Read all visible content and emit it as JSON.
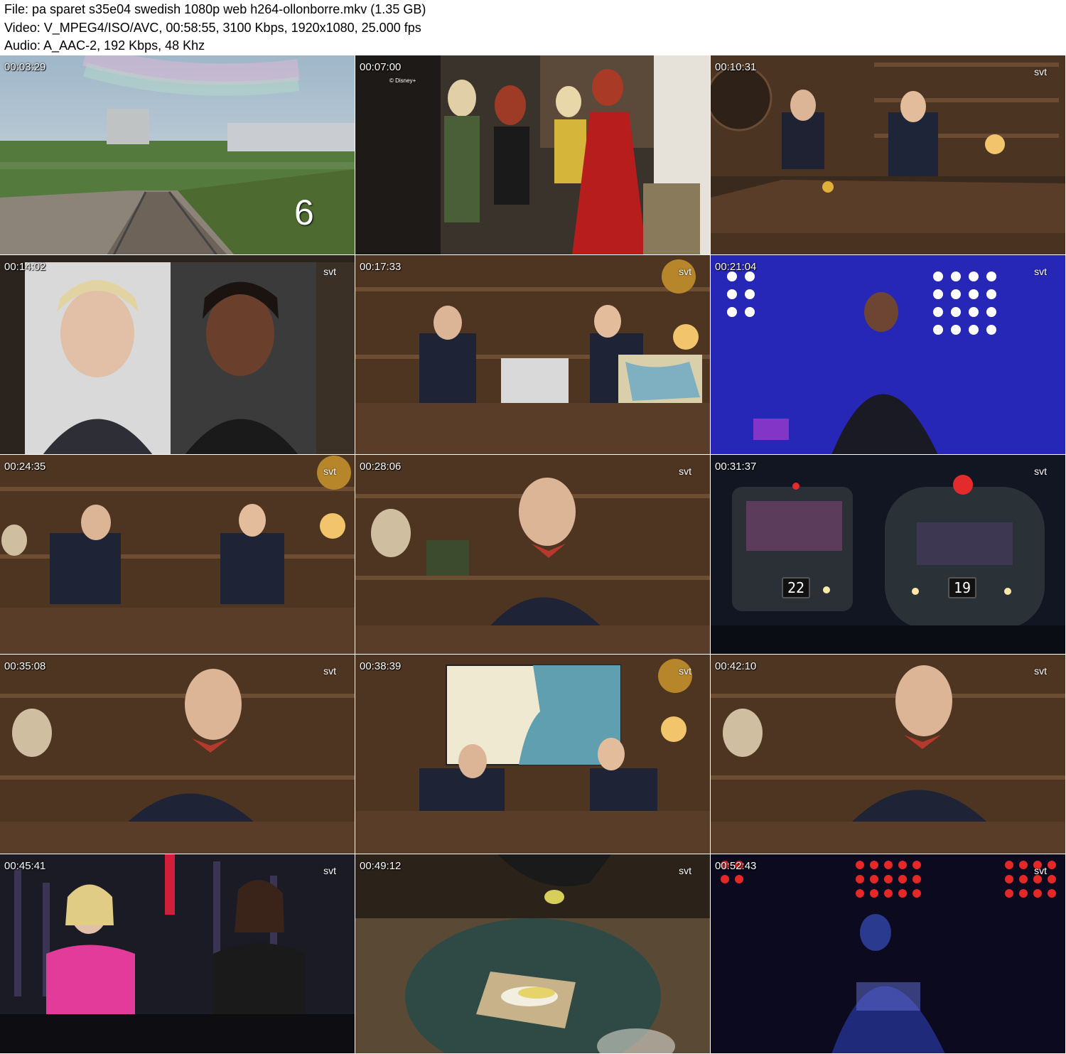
{
  "header": {
    "file_line": "File: pa sparet s35e04 swedish 1080p web h264-ollonborre.mkv (1.35 GB)",
    "video_line": "Video: V_MPEG4/ISO/AVC, 00:58:55, 3100 Kbps, 1920x1080, 25.000 fps",
    "audio_line": "Audio: A_AAC-2, 192 Kbps, 48 Khz"
  },
  "frames": [
    {
      "timestamp": "00:03:29",
      "overlay": "6"
    },
    {
      "timestamp": "00:07:00",
      "overlay": "© Disney+"
    },
    {
      "timestamp": "00:10:31",
      "channel": "svt"
    },
    {
      "timestamp": "00:14:02",
      "channel": "svt"
    },
    {
      "timestamp": "00:17:33",
      "channel": "svt"
    },
    {
      "timestamp": "00:21:04",
      "channel": "svt"
    },
    {
      "timestamp": "00:24:35",
      "channel": "svt"
    },
    {
      "timestamp": "00:28:06",
      "channel": "svt"
    },
    {
      "timestamp": "00:31:37",
      "channel": "svt",
      "score_left": "22",
      "score_right": "19"
    },
    {
      "timestamp": "00:35:08",
      "channel": "svt"
    },
    {
      "timestamp": "00:38:39",
      "channel": "svt"
    },
    {
      "timestamp": "00:42:10",
      "channel": "svt"
    },
    {
      "timestamp": "00:45:41",
      "channel": "svt"
    },
    {
      "timestamp": "00:49:12",
      "channel": "svt"
    },
    {
      "timestamp": "00:52:43",
      "channel": "svt"
    }
  ]
}
